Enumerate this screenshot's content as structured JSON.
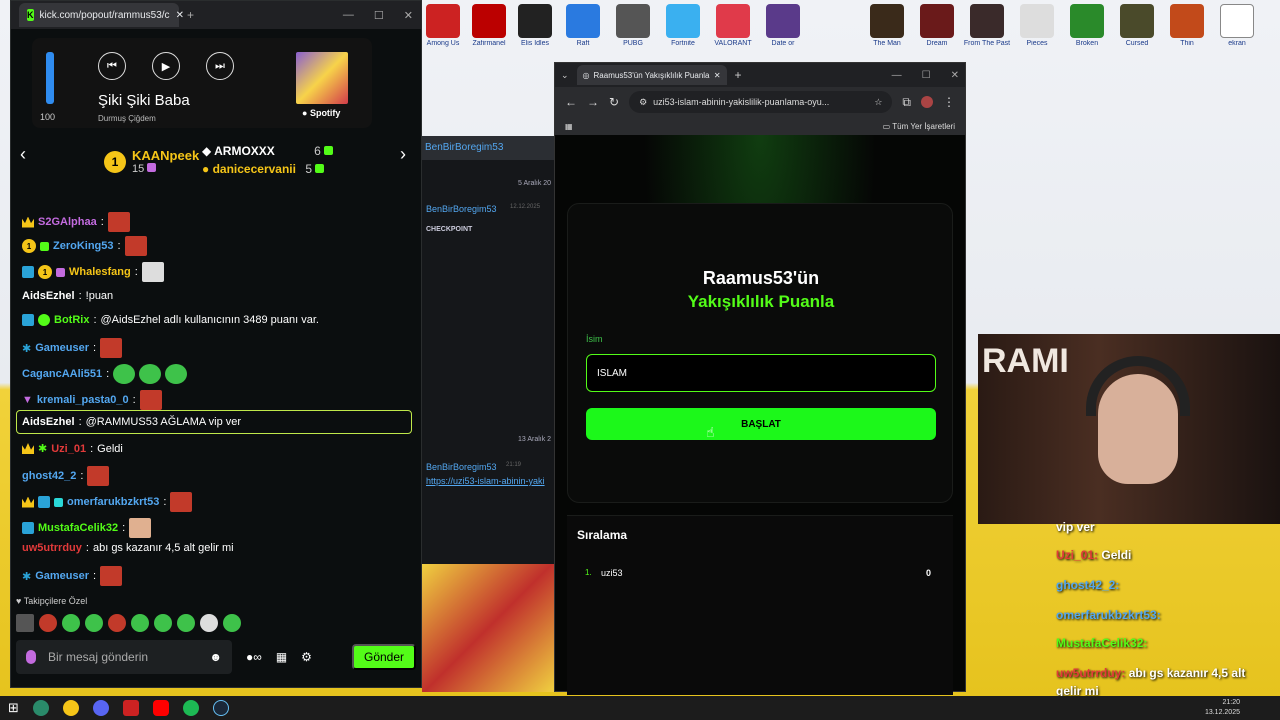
{
  "chat_window": {
    "tab_title": "kick.com/popout/rammus53/c",
    "spotify": {
      "volume": 100,
      "volume_label": "100",
      "song": "Şiki Şiki Baba",
      "artist": "Durmuş Çiğdem",
      "brand": "Spotify"
    },
    "leaderboard": {
      "first": {
        "name": "KAANpeek",
        "count": "15",
        "rank": "1"
      },
      "second": {
        "name": "ARMOXXX",
        "count": "6"
      },
      "third": {
        "name": "danicecervanii",
        "count": "5"
      }
    },
    "messages": [
      {
        "user": "S2GAlphaa",
        "color": "#c36bdf",
        "text": ""
      },
      {
        "user": "ZeroKing53",
        "color": "#53a7f0",
        "text": ""
      },
      {
        "user": "Whalesfang",
        "color": "#f5c518",
        "text": ""
      },
      {
        "user": "AidsEzhel",
        "color": "#ffffff",
        "text": "!puan"
      },
      {
        "user": "BotRix",
        "color": "#53fc18",
        "text": "@AidsEzhel adlı kullanıcının 3489 puanı var."
      },
      {
        "user": "Gameuser",
        "color": "#53a7f0",
        "text": ""
      },
      {
        "user": "CagancAAli551",
        "color": "#53a7f0",
        "text": ""
      },
      {
        "user": "kremali_pasta0_0",
        "color": "#53a7f0",
        "text": ""
      },
      {
        "user": "AidsEzhel",
        "color": "#ffffff",
        "text": "@RAMMUS53 AĞLAMA vip ver"
      },
      {
        "user": "Uzi_01",
        "color": "#e23a3a",
        "text": "Geldi"
      },
      {
        "user": "ghost42_2",
        "color": "#53a7f0",
        "text": ""
      },
      {
        "user": "omerfarukbzkrt53",
        "color": "#53a7f0",
        "text": ""
      },
      {
        "user": "MustafaCelik32",
        "color": "#53fc18",
        "text": ""
      },
      {
        "user": "uw5utrrduy",
        "color": "#e23a3a",
        "text": "abı gs kazanır 4,5 alt gelir mi"
      },
      {
        "user": "Gameuser",
        "color": "#53a7f0",
        "text": ""
      }
    ],
    "followers_label": "Takipçilere Özel",
    "input_placeholder": "Bir mesaj gönderin",
    "send_label": "Gönder"
  },
  "middle_window": {
    "tab": "BenBirBoregim53",
    "date1": "5 Aralık 20",
    "user1": "BenBirBoregim53",
    "stamp1": "12.12.2025",
    "checkpoint": "CHECKPOINT",
    "date2": "13 Aralık 2",
    "user2": "BenBirBoregim53",
    "stamp2": "21:19",
    "link": "https://uzi53-islam-abinin-yaki"
  },
  "browser": {
    "tab_title": "Raamus53'ün Yakışıklılık Puanla",
    "url": "uzi53-islam-abinin-yakislilik-puanlama-oyu...",
    "bookmarks": "Tüm Yer İşaretleri",
    "title_line1": "Raamus53'ün",
    "title_line2": "Yakışıklılık Puanla",
    "name_label": "İsim",
    "name_value": "İSLAM",
    "start_label": "BAŞLAT",
    "ranking_title": "Sıralama",
    "ranking": [
      {
        "pos": "1.",
        "name": "uzi53",
        "score": "0"
      }
    ]
  },
  "overlay": {
    "vip": "vip ver",
    "l1_user": "Uzi_01:",
    "l1_text": "Geldi",
    "l2_user": "ghost42_2:",
    "l3_user": "omerfarukbzkrt53:",
    "l4_user": "MustafaCelik32:",
    "l5_user": "uw5utrrduy:",
    "l5_text": "abı gs kazanır 4,5 alt",
    "l5_text2": "gelir mi",
    "cam_text": "RAMI"
  },
  "taskbar": {
    "time": "21:20",
    "date": "13.12.2025"
  }
}
